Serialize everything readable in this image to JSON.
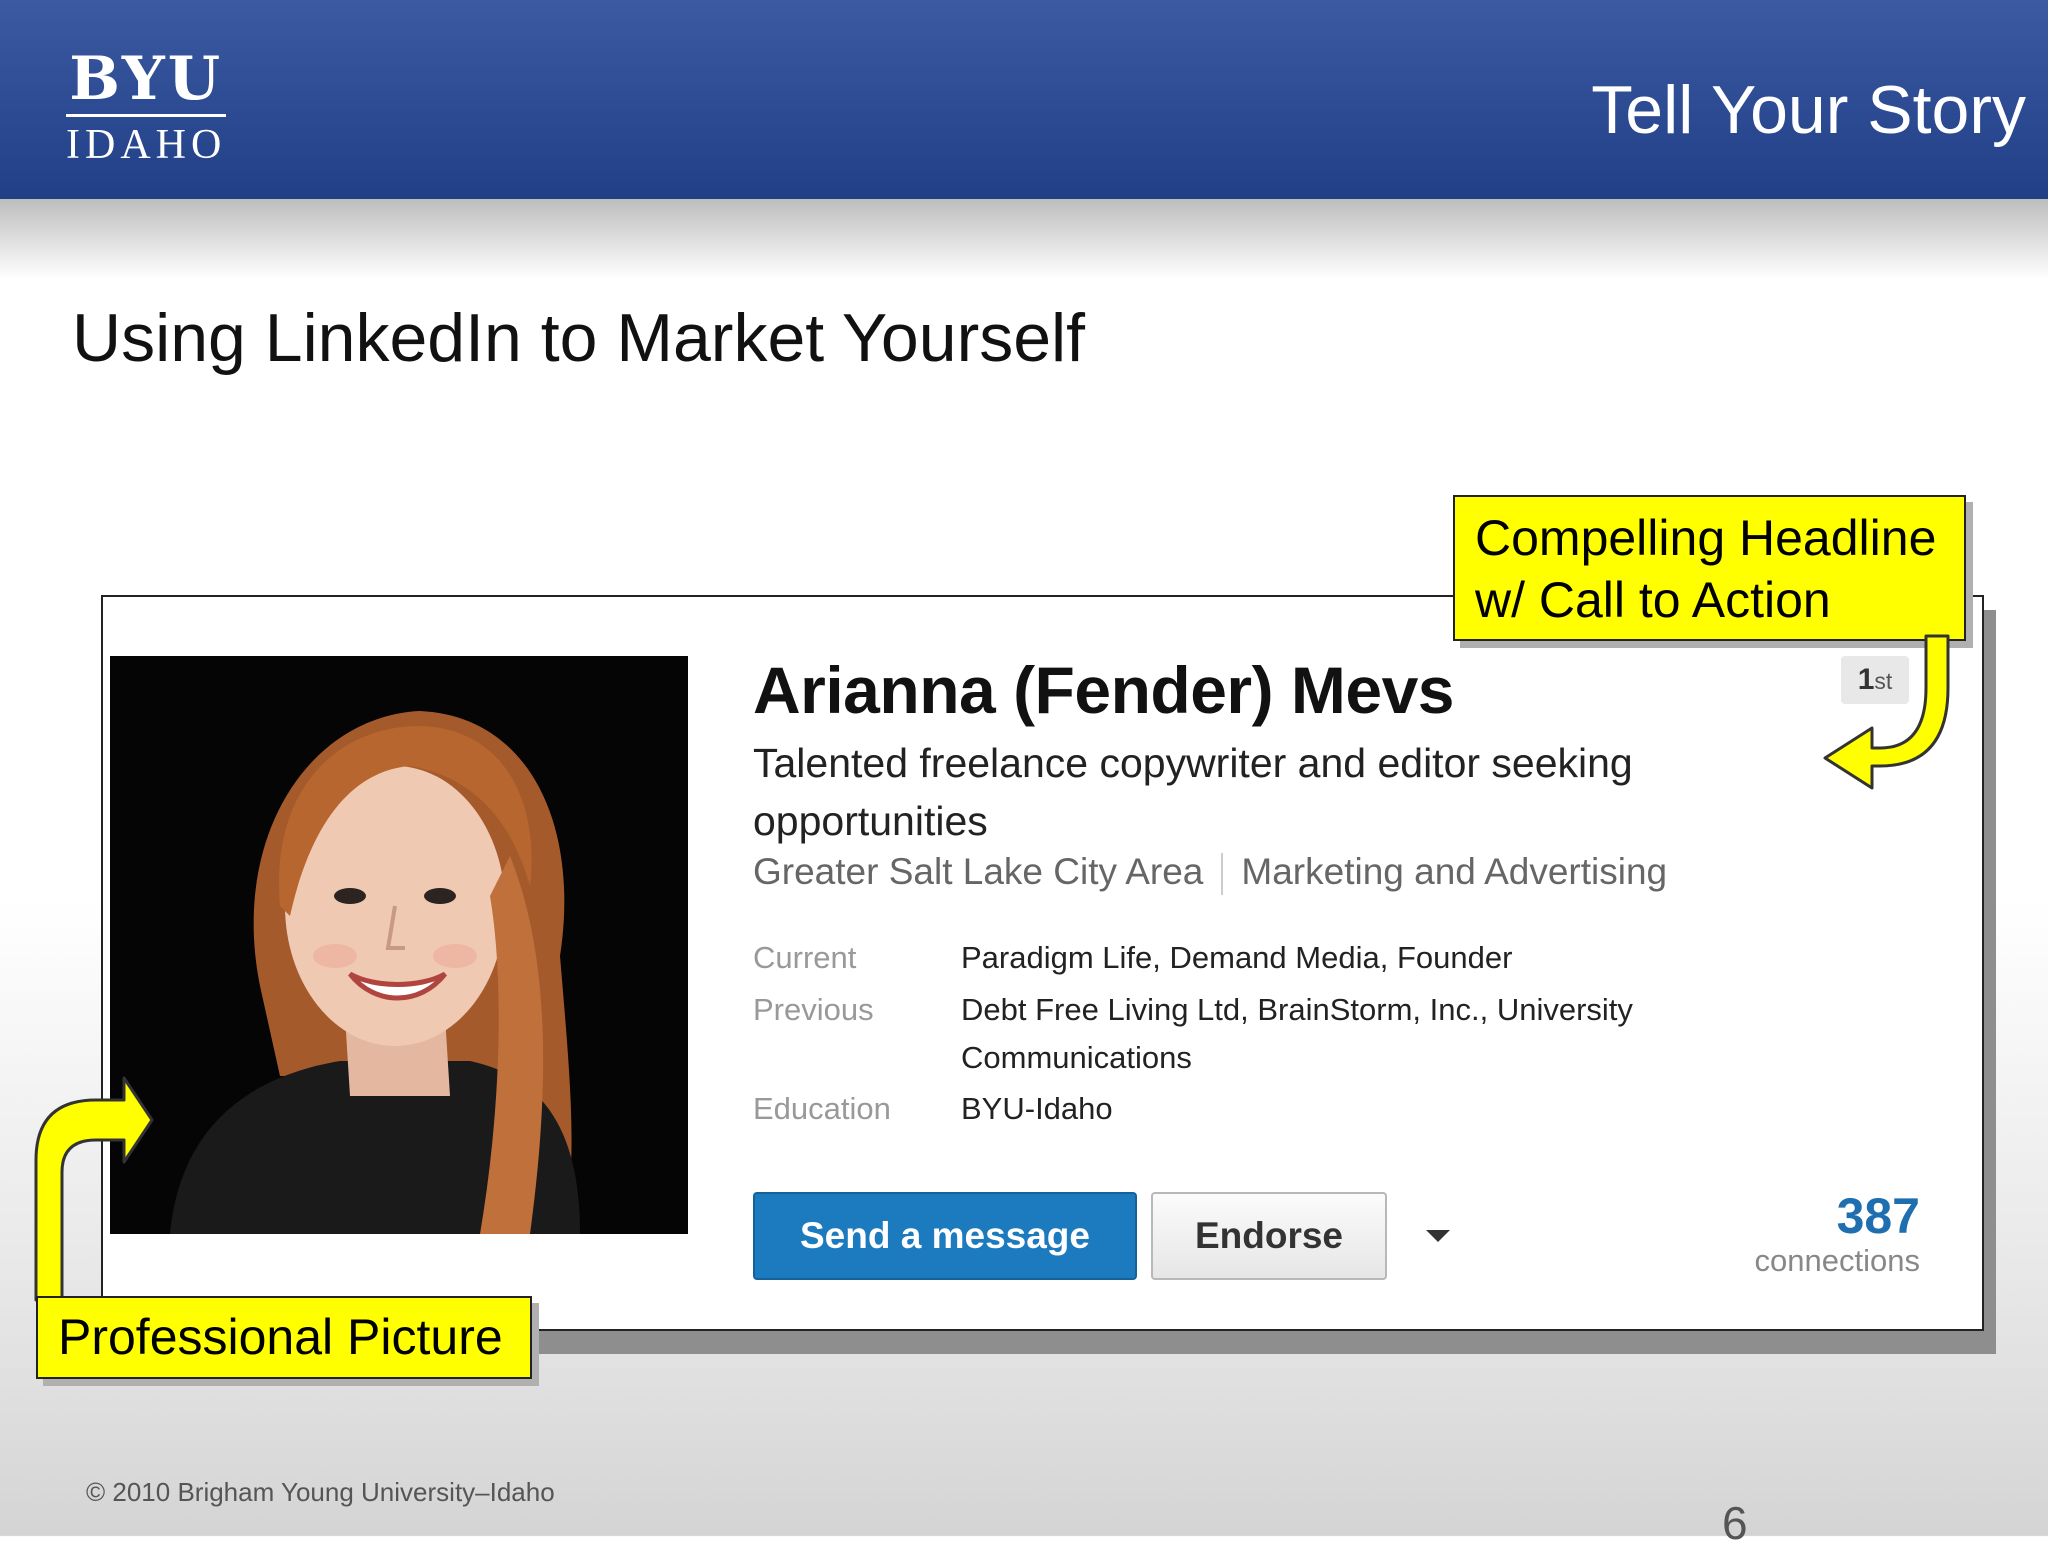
{
  "header": {
    "logo_top": "BYU",
    "logo_bottom": "IDAHO",
    "title": "Tell Your Story"
  },
  "slide": {
    "title": "Using LinkedIn to Market Yourself"
  },
  "profile": {
    "name": "Arianna (Fender) Mevs",
    "degree_number": "1",
    "degree_suffix": "st",
    "headline": "Talented freelance copywriter and editor seeking opportunities",
    "location": "Greater Salt Lake City Area",
    "industry": "Marketing and Advertising",
    "rows": [
      {
        "label": "Current",
        "value": "Paradigm Life, Demand Media, Founder"
      },
      {
        "label": "Previous",
        "value": "Debt Free Living Ltd, BrainStorm, Inc., University Communications"
      },
      {
        "label": "Education",
        "value": "BYU-Idaho"
      }
    ],
    "send_button": "Send a message",
    "endorse_button": "Endorse",
    "connections_count": "387",
    "connections_label": "connections"
  },
  "callouts": {
    "headline_line1": "Compelling Headline",
    "headline_line2": "w/ Call to Action",
    "picture": "Professional Picture"
  },
  "footer": {
    "copyright": "© 2010 Brigham Young University–Idaho",
    "page_number": "6"
  },
  "colors": {
    "header_blue": "#2a4a92",
    "callout_yellow": "#ffff00",
    "linkedin_blue": "#1c7abf"
  }
}
